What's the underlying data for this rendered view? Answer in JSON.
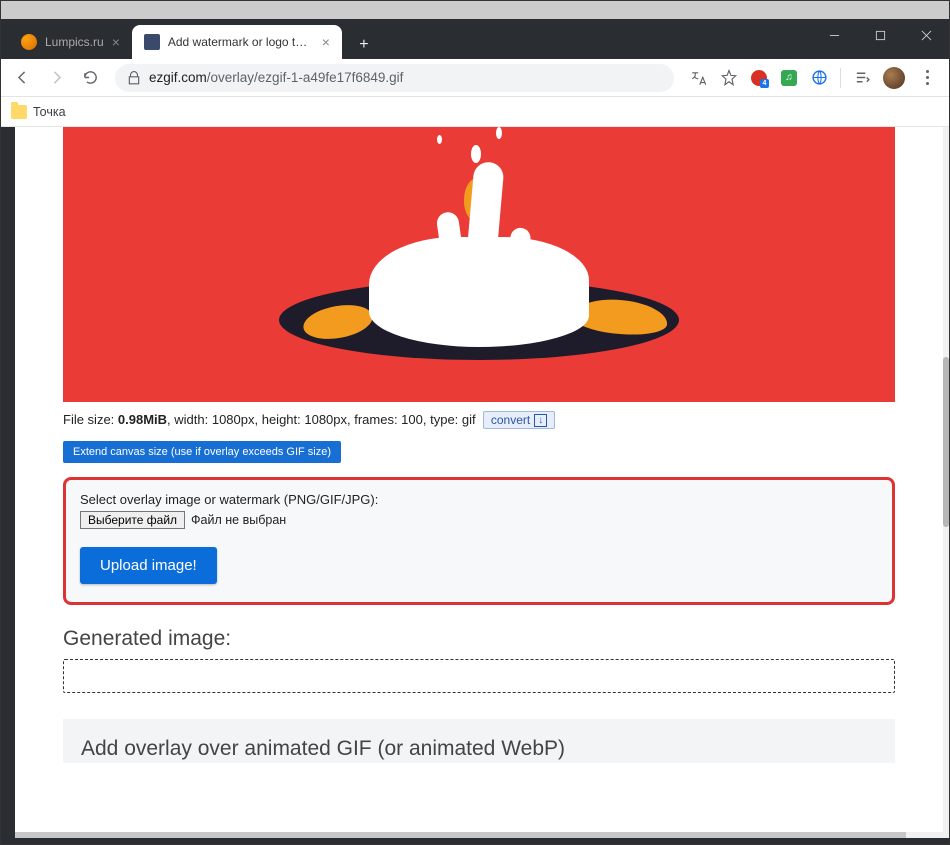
{
  "tabs": [
    {
      "title": "Lumpics.ru",
      "active": false
    },
    {
      "title": "Add watermark or logo to anima...",
      "active": true
    }
  ],
  "url": {
    "host": "ezgif.com",
    "path": "/overlay/ezgif-1-a49fe17f6849.gif"
  },
  "bookmarks": {
    "item0": "Точка"
  },
  "fileinfo": {
    "prefix": "File size: ",
    "size": "0.98MiB",
    "rest": ", width: 1080px, height: 1080px, frames: 100, type: gif",
    "convert": "convert"
  },
  "extend_label": "Extend canvas size (use if overlay exceeds GIF size)",
  "upload": {
    "label": "Select overlay image or watermark (PNG/GIF/JPG):",
    "choose": "Выберите файл",
    "status": "Файл не выбран",
    "submit": "Upload image!"
  },
  "generated_heading": "Generated image:",
  "bottom_heading": "Add overlay over animated GIF (or animated WebP)"
}
